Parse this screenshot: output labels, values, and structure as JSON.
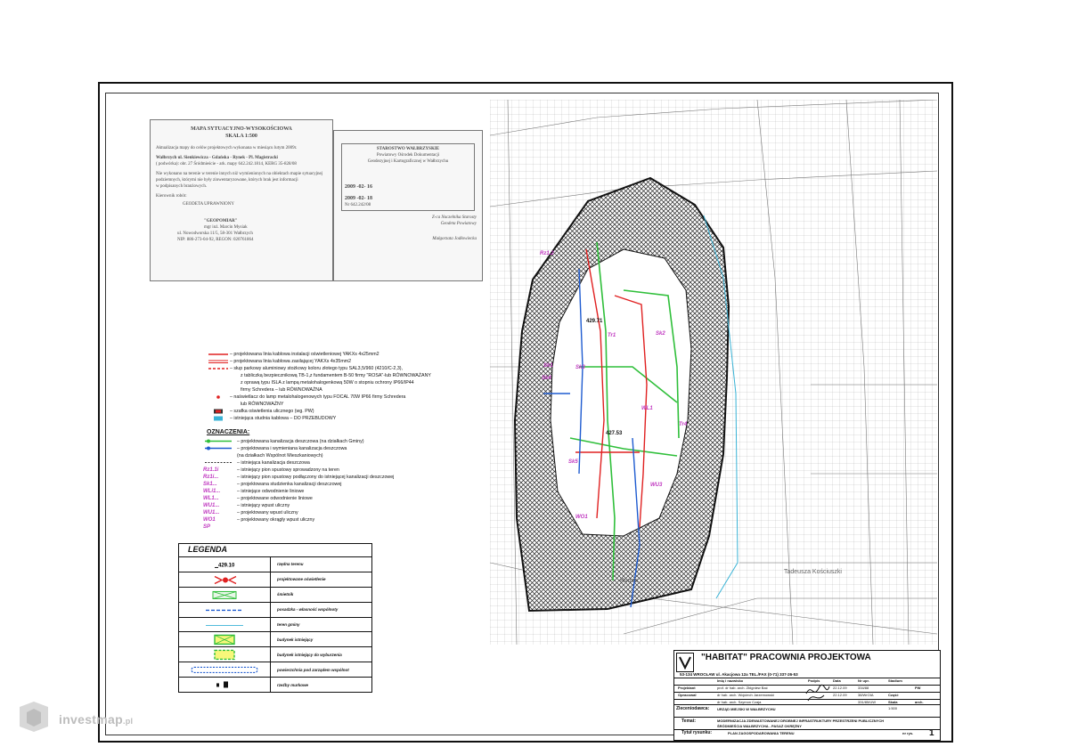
{
  "stamp_left": {
    "title": "MAPA SYTUACYJNO-WYSOKOŚCIOWA",
    "scale": "SKALA 1:500",
    "update": "Aktualizacja mapy do celów projektowych wykonana w miesiącu lutym 2009r.",
    "location": "Wałbrzych ul. Sienkiewicza - Gdańska - Rynek - Pl. Magistracki",
    "district": "( podwórka): obr. 27 Śródmieście - ark. mapy 642.242.1814, KERG 35-828/08",
    "note1": "Nie wykonano na terenie w terenie innych niż wymienionych na obiektach mapie sytuacyjnej",
    "note2": "podziemnych, którymi nie były zinwentaryzowane, których brak jest informacji",
    "note3": "w podpisanych branżowych.",
    "manager_label": "Kierownik robót:",
    "company": "GEODETA UPRAWNIONY",
    "company_name": "\"GEOPOMIAR\"",
    "surveyor": "mgr inż. Marcin Mysiak",
    "surveyor_addr": "ul. Nowodworska 11/5, 58-301 Wałbrzych",
    "surveyor_nip": "NIP: 886-273-04-92, REGON: 020761864"
  },
  "stamp_right": {
    "org1": "STAROSTWO WAŁBRZYSKIE",
    "org2": "Powiatowy Ośrodek Dokumentacji",
    "org3": "Geodezyjnej i Kartograficznej w Wałbrzychu",
    "date1": "2009 -02- 16",
    "date2": "2009 -02- 18",
    "regno": "Nr 642.242/08",
    "signature_note": "Małgorzata Jodłowiecka",
    "checker": "Z-ca Naczelnika Starosty",
    "checker2": "Geodeta Powiatowy"
  },
  "legend_top": {
    "items": [
      {
        "text": "– projektowana linia kablowa instalacji oświetleniowej YAKXs 4x25mm2",
        "sym": "red-line"
      },
      {
        "text": "– projektowana linia kablowa zasilającej YAKXs 4x35mm2",
        "sym": "red-double"
      },
      {
        "text": "– słup parkowy aluminiowy stożkowy koloru złotego typu SAL3,5/960 (4210/C-2,3),",
        "sym": "red-dash"
      },
      {
        "text": "z tabliczką bezpiecznikową TB-1,z  fundamentem B-50 firmy \"ROSA\"-lub RÓWNOWAŻANY",
        "sym": ""
      },
      {
        "text": "z oprawą typu ISLA z lampą metalohalogenkową 50W o stopniu ochrony IP66/IP44",
        "sym": ""
      },
      {
        "text": "firmy Schredera  –  lub RÓWNOWAŻNA",
        "sym": ""
      },
      {
        "text": "– naświetlacz do lamp metalohalogenowych typu FOCAL 70W IP66  firmy Schredera",
        "sym": "red-dot"
      },
      {
        "text": "lub RÓWNOWAŻNY",
        "sym": ""
      },
      {
        "text": "– szafka oświetlenia ulicznego (wg. PW)",
        "sym": "blue-box"
      },
      {
        "text": "– istniejąca studnia kablowa – DO PRZEBUDOWY",
        "sym": "cyan-box"
      }
    ]
  },
  "oznaczenia": {
    "heading": "OZNACZENIA:",
    "items": [
      {
        "code": "",
        "text": "– projektowana kanalizacja deszczowa (na działkach Gminy)"
      },
      {
        "code": "",
        "text": "– projektowana i wymieniana kanalizacja deszczowa"
      },
      {
        "code": "",
        "text": "(na działkach Wspólnot Mieszkaniowych)"
      },
      {
        "code": "",
        "text": "– istniejąca kanalizacja deszczowa"
      },
      {
        "code": "Rz1.1i",
        "text": "– istniejący pion spustowy sprowadzony na teren"
      },
      {
        "code": "Rz1i...",
        "text": "– istniejący pion spustowy podłączony do istniejącej kanalizacji deszczowej"
      },
      {
        "code": "Sk1...",
        "text": "– projektowana studzienka kanalizacji deszczowej"
      },
      {
        "code": "WLi1...",
        "text": "– istniejące odwodnienie liniowe"
      },
      {
        "code": "WL1...",
        "text": "– projektowane odwodnienie liniowe"
      },
      {
        "code": "WU1...",
        "text": "– istniejący wpust uliczny"
      },
      {
        "code": "WU1...",
        "text": "– projektowany wpust uliczny"
      },
      {
        "code": "WO1",
        "text": "– projektowany okrągły wpust uliczny"
      },
      {
        "code": "SP",
        "text": ""
      }
    ]
  },
  "legenda": {
    "title": "LEGENDA",
    "rows": [
      {
        "label": "rzędna terenu",
        "sym": "elevation",
        "elev": "429.10"
      },
      {
        "label": "projektowane oświetlenie",
        "sym": "light"
      },
      {
        "label": "śmietnik",
        "sym": "bin"
      },
      {
        "label": "posadzka - własność wspólnoty",
        "sym": "blue-dash"
      },
      {
        "label": "teren gminy",
        "sym": "thin-blue"
      },
      {
        "label": "budynek istniejący",
        "sym": "yellow-box"
      },
      {
        "label": "budynek istniejący do wyburzenia",
        "sym": "yellow-wave"
      },
      {
        "label": "powierzchnia pod zarządem wspólnot",
        "sym": "dashed-rect"
      },
      {
        "label": "rzeźby murkowe",
        "sym": "stones"
      }
    ]
  },
  "map": {
    "labels": [
      {
        "text": "Rynek"
      },
      {
        "text": "Tadeusza Kościuszki"
      },
      {
        "text": "Sk2"
      },
      {
        "text": "Sk1"
      },
      {
        "text": "WL1"
      },
      {
        "text": "Tr1"
      },
      {
        "text": "Tr4"
      },
      {
        "text": "Rz1.2"
      },
      {
        "text": "Sk3"
      },
      {
        "text": "Sk4"
      },
      {
        "text": "Sk5"
      },
      {
        "text": "WU3"
      },
      {
        "text": "WO1"
      },
      {
        "text": "429.71"
      },
      {
        "text": "427.53"
      }
    ]
  },
  "title_block": {
    "office_title": "\"HABITAT\" PRACOWNIA PROJEKTOWA",
    "address": "53-134 WROCŁAW    ul. Akacjowa 12a  TEL./FAX (0-71) 337-26-53",
    "col_headers": [
      "Imię i nazwisko",
      "Podpis",
      "Data",
      "Nr upr.",
      "Stadium"
    ],
    "rows": [
      {
        "role": "Projektant",
        "name": "prof. dr hab. arch. Zbigniew Bać",
        "date": "22.12.09",
        "no": "334/88",
        "stage": "PW"
      },
      {
        "role": "Opracował",
        "name": "dr hab. arch. Wojciech Jarzemowski",
        "date": "22.12.09",
        "no": "38/WrOIA",
        "stage": "Część"
      },
      {
        "role": "",
        "name": "dr hab. arch. Szymon Czaja",
        "date": "",
        "no": "331/85/UW",
        "stage": "arch."
      }
    ],
    "scale_label": "Skala",
    "scale_value": "1:500",
    "client_label": "Zleceniodawca:",
    "client": "URZĄD MIEJSKI W WAŁBRZYCHU",
    "topic_label": "Temat:",
    "topic": "MODERNIZACJA ZDEWASTOWANEJ DROBNEJ INFRASTRUKTURY PRZESTRZENI PUBLICZNYCH",
    "topic2": "ŚRÓDMIEŚCIA WAŁBRZYCHA - PASAŻ OKRĘŻNY",
    "drawing_label": "Tytuł rysunku:",
    "drawing": "PLAN ZAGOSPODAROWANIA TERENU",
    "sheet_label": "nr rys.",
    "sheet_no": "1"
  },
  "watermark": {
    "brand": "investmap",
    "suffix": ".pl"
  },
  "colors": {
    "red": "#e02020",
    "green": "#2fbf3a",
    "blue": "#1e5bd0",
    "magenta": "#c038c0",
    "cyan": "#39b3d6",
    "dark": "#111111"
  }
}
